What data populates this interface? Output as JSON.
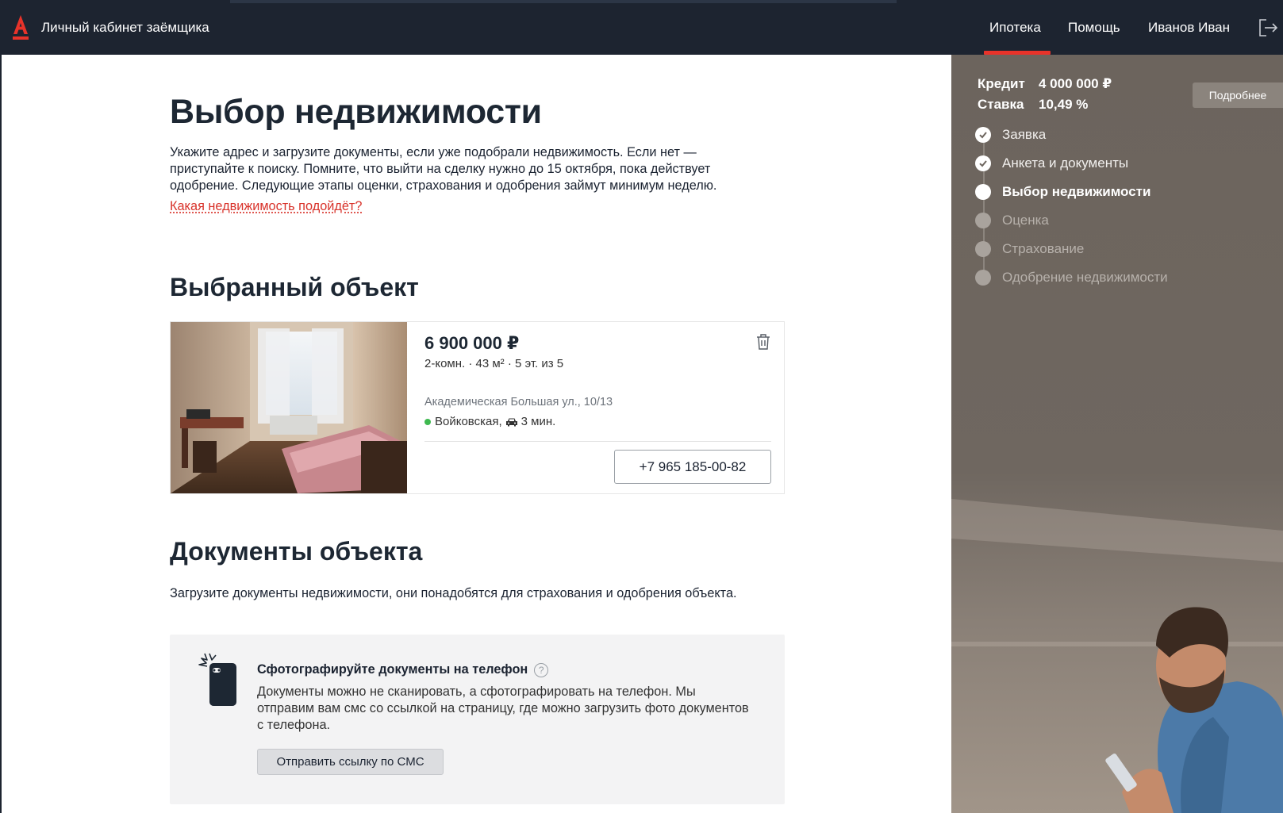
{
  "header": {
    "brand_letter": "А",
    "brand_title": "Личный кабинет заёмщика",
    "nav": [
      {
        "label": "Ипотека",
        "active": true
      },
      {
        "label": "Помощь",
        "active": false
      },
      {
        "label": "Иванов Иван",
        "active": false
      }
    ],
    "logout_icon": "logout-icon"
  },
  "main": {
    "title": "Выбор недвижимости",
    "intro": "Укажите адрес и загрузите документы, если уже подобрали недвижимость. Если нет — приступайте к поиску. Помните, что выйти на сделку нужно до 15 октября, пока действует одобрение. Следующие этапы оценки, страхования и одобрения займут минимум неделю.",
    "intro_link": "Какая недвижимость подойдёт?",
    "selected_title": "Выбранный объект",
    "property": {
      "price": "6 900 000 ₽",
      "specs": "2-комн. · 43 м² · 5 эт. из 5",
      "address": "Академическая Большая ул., 10/13",
      "metro": "Войковская,",
      "travel": "3 мин.",
      "phone": "+7 965 185-00-82",
      "metro_color": "#3fb950"
    },
    "docs_title": "Документы объекта",
    "docs_text": "Загрузите документы недвижимости, они понадобятся для страхования и одобрения объекта.",
    "docs_box": {
      "title": "Сфотографируйте документы на телефон",
      "help": "?",
      "desc": "Документы можно не сканировать, а сфотографировать на телефон. Мы отправим вам смс со ссылкой на страницу, где можно загрузить фото документов с телефона.",
      "button": "Отправить ссылку по СМС"
    }
  },
  "sidebar": {
    "credit_label": "Кредит",
    "credit_value": "4 000 000 ₽",
    "rate_label": "Ставка",
    "rate_value": "10,49 %",
    "more_button": "Подробнее",
    "steps": [
      {
        "label": "Заявка",
        "state": "done"
      },
      {
        "label": "Анкета и документы",
        "state": "done"
      },
      {
        "label": "Выбор недвижимости",
        "state": "current"
      },
      {
        "label": "Оценка",
        "state": "todo"
      },
      {
        "label": "Страхование",
        "state": "todo"
      },
      {
        "label": "Одобрение недвижимости",
        "state": "todo"
      }
    ]
  },
  "colors": {
    "accent": "#e8332a",
    "header_bg": "#1d2430",
    "sidebar_bg": "#6d655e"
  }
}
